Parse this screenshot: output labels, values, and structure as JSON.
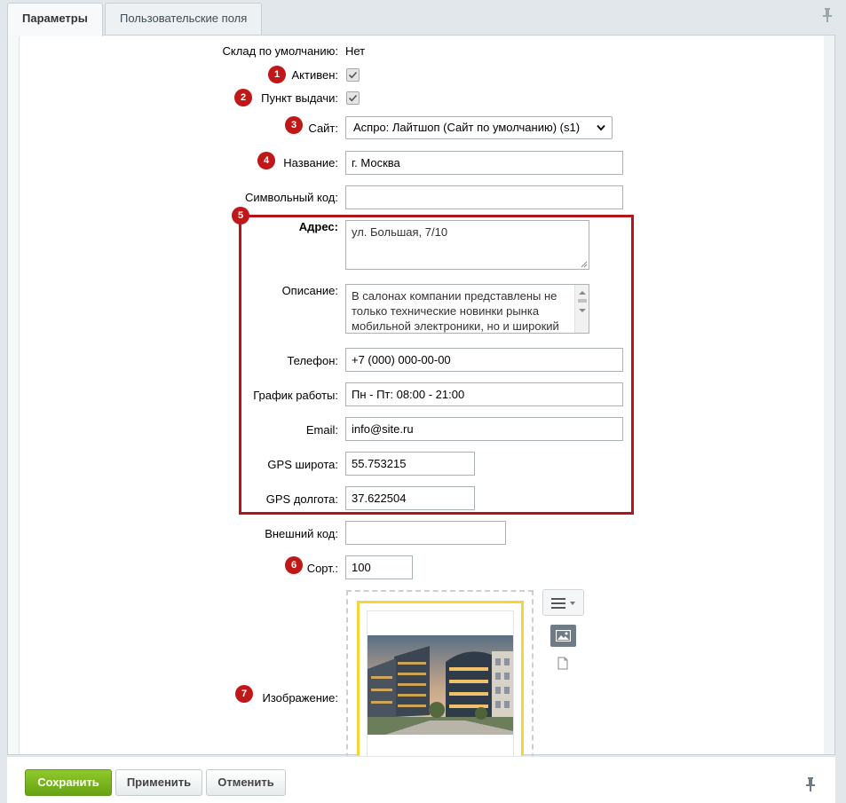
{
  "tabs": [
    {
      "label": "Параметры",
      "active": true
    },
    {
      "label": "Пользовательские поля",
      "active": false
    }
  ],
  "fields": {
    "default_store": {
      "label": "Склад по умолчанию:",
      "value": "Нет"
    },
    "active": {
      "badge": "1",
      "label": "Активен:",
      "checked": true
    },
    "pickup": {
      "badge": "2",
      "label": "Пункт выдачи:",
      "checked": true
    },
    "site": {
      "badge": "3",
      "label": "Сайт:",
      "value": "Аспро: Лайтшоп (Сайт по умолчанию) (s1)"
    },
    "name": {
      "badge": "4",
      "label": "Название:",
      "value": "г. Москва"
    },
    "code": {
      "label": "Символьный код:",
      "value": ""
    },
    "address_group_badge": "5",
    "address": {
      "label": "Адрес:",
      "value": "ул. Большая, 7/10"
    },
    "description": {
      "label": "Описание:",
      "value": "В салонах компании представлены не только технические новинки рынка мобильной электроники, но и широкий выбор аксессуаров. Сотрудники"
    },
    "phone": {
      "label": "Телефон:",
      "value": "+7 (000) 000-00-00"
    },
    "schedule": {
      "label": "График работы:",
      "value": "Пн - Пт: 08:00 - 21:00"
    },
    "email": {
      "label": "Email:",
      "value": "info@site.ru"
    },
    "gps_lat": {
      "label": "GPS широта:",
      "value": "55.753215"
    },
    "gps_lon": {
      "label": "GPS долгота:",
      "value": "37.622504"
    },
    "external_code": {
      "label": "Внешний код:",
      "value": ""
    },
    "sort": {
      "badge": "6",
      "label": "Сорт.:",
      "value": "100"
    },
    "image": {
      "badge": "7",
      "label": "Изображение:"
    }
  },
  "footer": {
    "save": "Сохранить",
    "apply": "Применить",
    "cancel": "Отменить"
  },
  "colors": {
    "badge": "#c01818",
    "highlight_frame": "#b4151b",
    "save_button": "#7bb61f",
    "image_selected": "#f3d73a"
  },
  "icons": [
    "pin-icon",
    "checkmark-icon",
    "dropdown-arrow-icon",
    "menu-icon",
    "image-icon",
    "file-icon"
  ]
}
